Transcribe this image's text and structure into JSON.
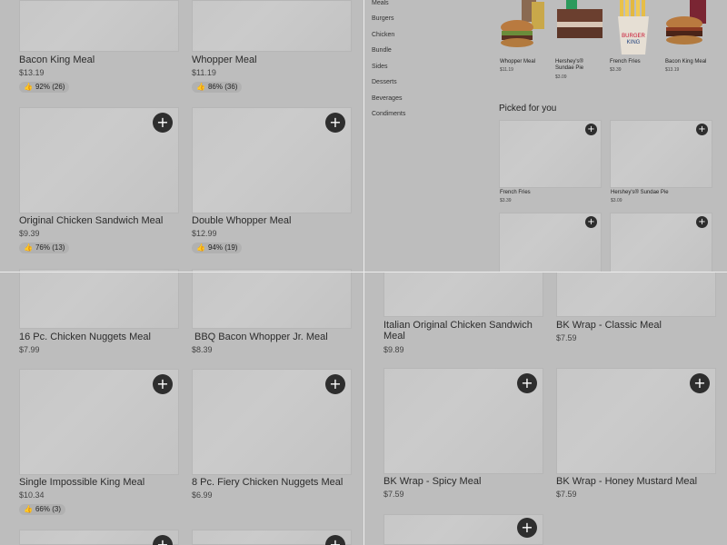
{
  "q1": {
    "cards": [
      {
        "name": "Bacon King Meal",
        "price": "$13.19",
        "rating": "92% (26)"
      },
      {
        "name": "Whopper Meal",
        "price": "$11.19",
        "rating": "86% (36)"
      },
      {
        "name": "Original Chicken Sandwich Meal",
        "price": "$9.39",
        "rating": "76% (13)"
      },
      {
        "name": "Double Whopper Meal",
        "price": "$12.99",
        "rating": "94% (19)"
      }
    ]
  },
  "q2": {
    "categories": [
      "Meals",
      "Burgers",
      "Chicken",
      "Bundle",
      "Sides",
      "Desserts",
      "Beverages",
      "Condiments"
    ],
    "featured": [
      {
        "name": "Whopper Meal",
        "price": "$11.19"
      },
      {
        "name": "Hershey's® Sundae Pie",
        "price": "$3.09"
      },
      {
        "name": "French Fries",
        "price": "$3.39"
      },
      {
        "name": "Bacon King Meal",
        "price": "$13.19"
      }
    ],
    "picked_title": "Picked for you",
    "picked": [
      {
        "name": "French Fries",
        "price": "$3.39"
      },
      {
        "name": "Hershey's® Sundae Pie",
        "price": "$3.09"
      }
    ]
  },
  "q3": {
    "cards": [
      {
        "name": "16 Pc. Chicken Nuggets Meal",
        "price": "$7.99"
      },
      {
        "name": "BBQ Bacon Whopper Jr. Meal",
        "price": "$8.39"
      },
      {
        "name": "Single Impossible King Meal",
        "price": "$10.34",
        "rating": "66% (3)"
      },
      {
        "name": "8 Pc. Fiery Chicken Nuggets Meal",
        "price": "$6.99"
      }
    ]
  },
  "q4": {
    "cards": [
      {
        "name": "Italian Original Chicken Sandwich Meal",
        "price": "$9.89"
      },
      {
        "name": "BK Wrap - Classic Meal",
        "price": "$7.59"
      },
      {
        "name": "BK Wrap - Spicy Meal",
        "price": "$7.59"
      },
      {
        "name": "BK Wrap - Honey Mustard Meal",
        "price": "$7.59"
      }
    ]
  },
  "icons": {
    "plus": "+",
    "thumb": "👍"
  },
  "colors": {
    "overlay": "#bdbdbd",
    "plus_button": "#2e2e2e"
  }
}
